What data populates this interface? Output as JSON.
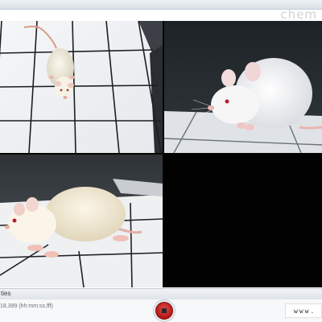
{
  "app": {
    "watermark": "chem"
  },
  "cameras": [
    {
      "id": "camera-1",
      "subject": "white rat on grid floor, top view"
    },
    {
      "id": "camera-2",
      "subject": "white rat close-up, side view"
    },
    {
      "id": "camera-3",
      "subject": "white rat on grid floor, side view"
    },
    {
      "id": "camera-4",
      "subject": "no signal"
    }
  ],
  "properties_panel": {
    "label": "ties"
  },
  "playback": {
    "time_readout": "18,399 (hh:mm:ss,fff)",
    "stop_icon": "stop-icon",
    "stop_color": "#c41f1f"
  },
  "footer": {
    "website": "www. qu"
  }
}
